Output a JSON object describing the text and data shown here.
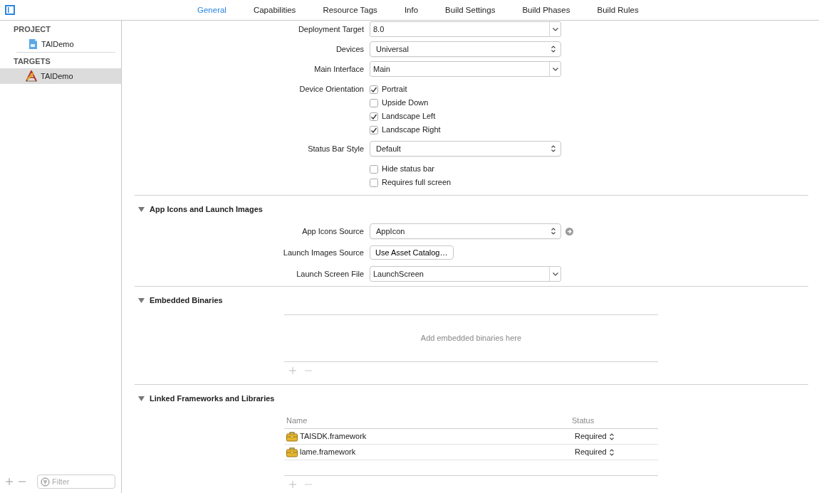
{
  "tabs": [
    {
      "label": "General",
      "selected": true
    },
    {
      "label": "Capabilities",
      "selected": false
    },
    {
      "label": "Resource Tags",
      "selected": false
    },
    {
      "label": "Info",
      "selected": false
    },
    {
      "label": "Build Settings",
      "selected": false
    },
    {
      "label": "Build Phases",
      "selected": false
    },
    {
      "label": "Build Rules",
      "selected": false
    }
  ],
  "sidebar": {
    "sections": [
      {
        "title": "PROJECT",
        "items": [
          {
            "label": "TAIDemo",
            "kind": "project",
            "selected": false
          }
        ]
      },
      {
        "title": "TARGETS",
        "items": [
          {
            "label": "TAIDemo",
            "kind": "target",
            "selected": true
          }
        ]
      }
    ],
    "filter": {
      "placeholder": "Filter"
    }
  },
  "deployment_rows": [
    {
      "kind": "combo",
      "label": "Deployment Target",
      "value": "8.0"
    },
    {
      "kind": "popup",
      "label": "Devices",
      "value": "Universal"
    },
    {
      "kind": "combo",
      "label": "Main Interface",
      "value": "Main"
    },
    {
      "kind": "checks",
      "label": "Device Orientation",
      "options": [
        {
          "label": "Portrait",
          "checked": true
        },
        {
          "label": "Upside Down",
          "checked": false
        },
        {
          "label": "Landscape Left",
          "checked": true
        },
        {
          "label": "Landscape Right",
          "checked": true
        }
      ]
    },
    {
      "kind": "popup",
      "label": "Status Bar Style",
      "value": "Default"
    },
    {
      "kind": "checks",
      "options": [
        {
          "label": "Hide status bar",
          "checked": false
        },
        {
          "label": "Requires full screen",
          "checked": false
        }
      ]
    }
  ],
  "sections": [
    {
      "title": "App Icons and Launch Images",
      "expanded": true,
      "rows": [
        {
          "kind": "popup",
          "label": "App Icons Source",
          "value": "AppIcon",
          "go_arrow": true
        },
        {
          "kind": "button",
          "label": "Launch Images Source",
          "value": "Use Asset Catalog…"
        },
        {
          "kind": "combo",
          "label": "Launch Screen File",
          "value": "LaunchScreen"
        }
      ]
    },
    {
      "title": "Embedded Binaries",
      "expanded": true,
      "empty_text": "Add embedded binaries here"
    },
    {
      "title": "Linked Frameworks and Libraries",
      "expanded": true,
      "table": {
        "columns": [
          "Name",
          "Status"
        ],
        "rows": [
          {
            "name": "TAISDK.framework",
            "status": "Required"
          },
          {
            "name": "lame.framework",
            "status": "Required"
          }
        ]
      }
    }
  ]
}
